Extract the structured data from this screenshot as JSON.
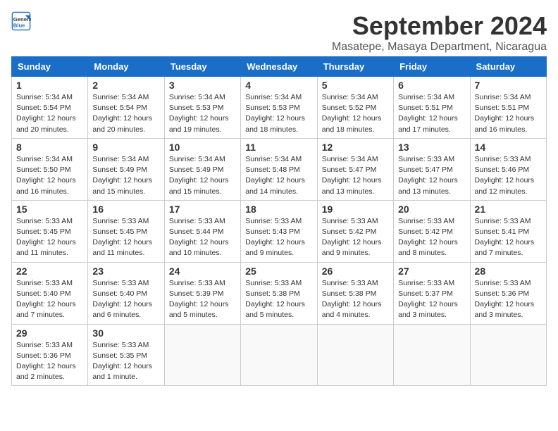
{
  "header": {
    "logo_line1": "General",
    "logo_line2": "Blue",
    "month": "September 2024",
    "location": "Masatepe, Masaya Department, Nicaragua"
  },
  "weekdays": [
    "Sunday",
    "Monday",
    "Tuesday",
    "Wednesday",
    "Thursday",
    "Friday",
    "Saturday"
  ],
  "weeks": [
    [
      {
        "day": 1,
        "sunrise": "5:34 AM",
        "sunset": "5:54 PM",
        "daylight": "12 hours and 20 minutes."
      },
      {
        "day": 2,
        "sunrise": "5:34 AM",
        "sunset": "5:54 PM",
        "daylight": "12 hours and 20 minutes."
      },
      {
        "day": 3,
        "sunrise": "5:34 AM",
        "sunset": "5:53 PM",
        "daylight": "12 hours and 19 minutes."
      },
      {
        "day": 4,
        "sunrise": "5:34 AM",
        "sunset": "5:53 PM",
        "daylight": "12 hours and 18 minutes."
      },
      {
        "day": 5,
        "sunrise": "5:34 AM",
        "sunset": "5:52 PM",
        "daylight": "12 hours and 18 minutes."
      },
      {
        "day": 6,
        "sunrise": "5:34 AM",
        "sunset": "5:51 PM",
        "daylight": "12 hours and 17 minutes."
      },
      {
        "day": 7,
        "sunrise": "5:34 AM",
        "sunset": "5:51 PM",
        "daylight": "12 hours and 16 minutes."
      }
    ],
    [
      {
        "day": 8,
        "sunrise": "5:34 AM",
        "sunset": "5:50 PM",
        "daylight": "12 hours and 16 minutes."
      },
      {
        "day": 9,
        "sunrise": "5:34 AM",
        "sunset": "5:49 PM",
        "daylight": "12 hours and 15 minutes."
      },
      {
        "day": 10,
        "sunrise": "5:34 AM",
        "sunset": "5:49 PM",
        "daylight": "12 hours and 15 minutes."
      },
      {
        "day": 11,
        "sunrise": "5:34 AM",
        "sunset": "5:48 PM",
        "daylight": "12 hours and 14 minutes."
      },
      {
        "day": 12,
        "sunrise": "5:34 AM",
        "sunset": "5:47 PM",
        "daylight": "12 hours and 13 minutes."
      },
      {
        "day": 13,
        "sunrise": "5:33 AM",
        "sunset": "5:47 PM",
        "daylight": "12 hours and 13 minutes."
      },
      {
        "day": 14,
        "sunrise": "5:33 AM",
        "sunset": "5:46 PM",
        "daylight": "12 hours and 12 minutes."
      }
    ],
    [
      {
        "day": 15,
        "sunrise": "5:33 AM",
        "sunset": "5:45 PM",
        "daylight": "12 hours and 11 minutes."
      },
      {
        "day": 16,
        "sunrise": "5:33 AM",
        "sunset": "5:45 PM",
        "daylight": "12 hours and 11 minutes."
      },
      {
        "day": 17,
        "sunrise": "5:33 AM",
        "sunset": "5:44 PM",
        "daylight": "12 hours and 10 minutes."
      },
      {
        "day": 18,
        "sunrise": "5:33 AM",
        "sunset": "5:43 PM",
        "daylight": "12 hours and 9 minutes."
      },
      {
        "day": 19,
        "sunrise": "5:33 AM",
        "sunset": "5:42 PM",
        "daylight": "12 hours and 9 minutes."
      },
      {
        "day": 20,
        "sunrise": "5:33 AM",
        "sunset": "5:42 PM",
        "daylight": "12 hours and 8 minutes."
      },
      {
        "day": 21,
        "sunrise": "5:33 AM",
        "sunset": "5:41 PM",
        "daylight": "12 hours and 7 minutes."
      }
    ],
    [
      {
        "day": 22,
        "sunrise": "5:33 AM",
        "sunset": "5:40 PM",
        "daylight": "12 hours and 7 minutes."
      },
      {
        "day": 23,
        "sunrise": "5:33 AM",
        "sunset": "5:40 PM",
        "daylight": "12 hours and 6 minutes."
      },
      {
        "day": 24,
        "sunrise": "5:33 AM",
        "sunset": "5:39 PM",
        "daylight": "12 hours and 5 minutes."
      },
      {
        "day": 25,
        "sunrise": "5:33 AM",
        "sunset": "5:38 PM",
        "daylight": "12 hours and 5 minutes."
      },
      {
        "day": 26,
        "sunrise": "5:33 AM",
        "sunset": "5:38 PM",
        "daylight": "12 hours and 4 minutes."
      },
      {
        "day": 27,
        "sunrise": "5:33 AM",
        "sunset": "5:37 PM",
        "daylight": "12 hours and 3 minutes."
      },
      {
        "day": 28,
        "sunrise": "5:33 AM",
        "sunset": "5:36 PM",
        "daylight": "12 hours and 3 minutes."
      }
    ],
    [
      {
        "day": 29,
        "sunrise": "5:33 AM",
        "sunset": "5:36 PM",
        "daylight": "12 hours and 2 minutes."
      },
      {
        "day": 30,
        "sunrise": "5:33 AM",
        "sunset": "5:35 PM",
        "daylight": "12 hours and 1 minute."
      },
      null,
      null,
      null,
      null,
      null
    ]
  ]
}
